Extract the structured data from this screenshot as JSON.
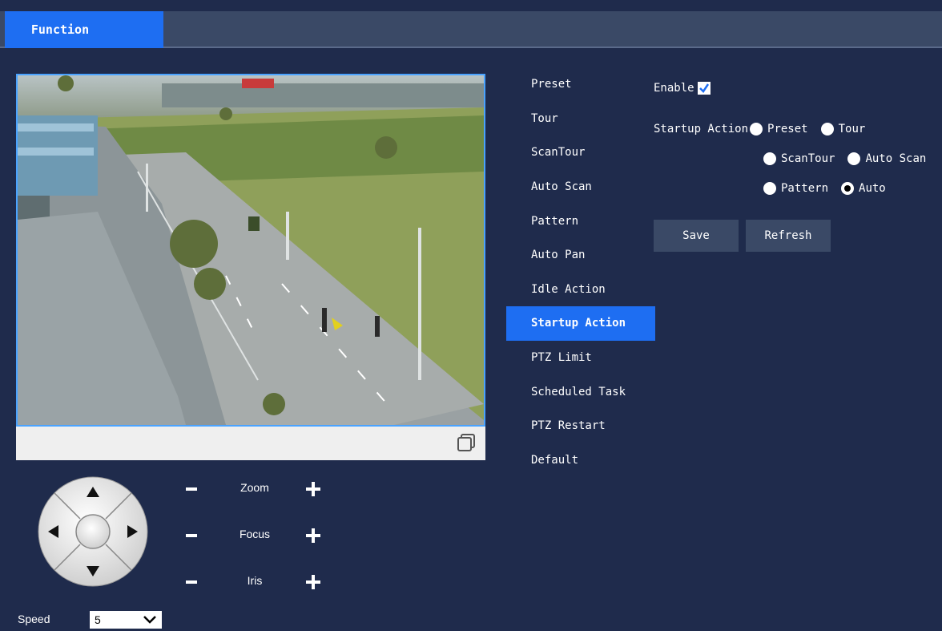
{
  "header": {
    "tab_label": "Function"
  },
  "ptz": {
    "zoom_label": "Zoom",
    "focus_label": "Focus",
    "iris_label": "Iris",
    "speed_label": "Speed",
    "speed_value": "5"
  },
  "menu": {
    "items": [
      {
        "label": "Preset"
      },
      {
        "label": "Tour"
      },
      {
        "label": "ScanTour"
      },
      {
        "label": "Auto Scan"
      },
      {
        "label": "Pattern"
      },
      {
        "label": "Auto Pan"
      },
      {
        "label": "Idle Action"
      },
      {
        "label": "Startup Action",
        "active": true
      },
      {
        "label": "PTZ Limit"
      },
      {
        "label": "Scheduled Task"
      },
      {
        "label": "PTZ Restart"
      },
      {
        "label": "Default"
      }
    ]
  },
  "form": {
    "enable_label": "Enable",
    "enable_checked": true,
    "startup_action_label": "Startup Action",
    "options": [
      {
        "label": "Preset",
        "checked": false
      },
      {
        "label": "Tour",
        "checked": false
      },
      {
        "label": "ScanTour",
        "checked": false
      },
      {
        "label": "Auto Scan",
        "checked": false
      },
      {
        "label": "Pattern",
        "checked": false
      },
      {
        "label": "Auto",
        "checked": true
      }
    ],
    "save_label": "Save",
    "refresh_label": "Refresh"
  },
  "colors": {
    "background": "#1f2b4c",
    "accent": "#1e6ef2",
    "topbar": "#3a4966"
  }
}
